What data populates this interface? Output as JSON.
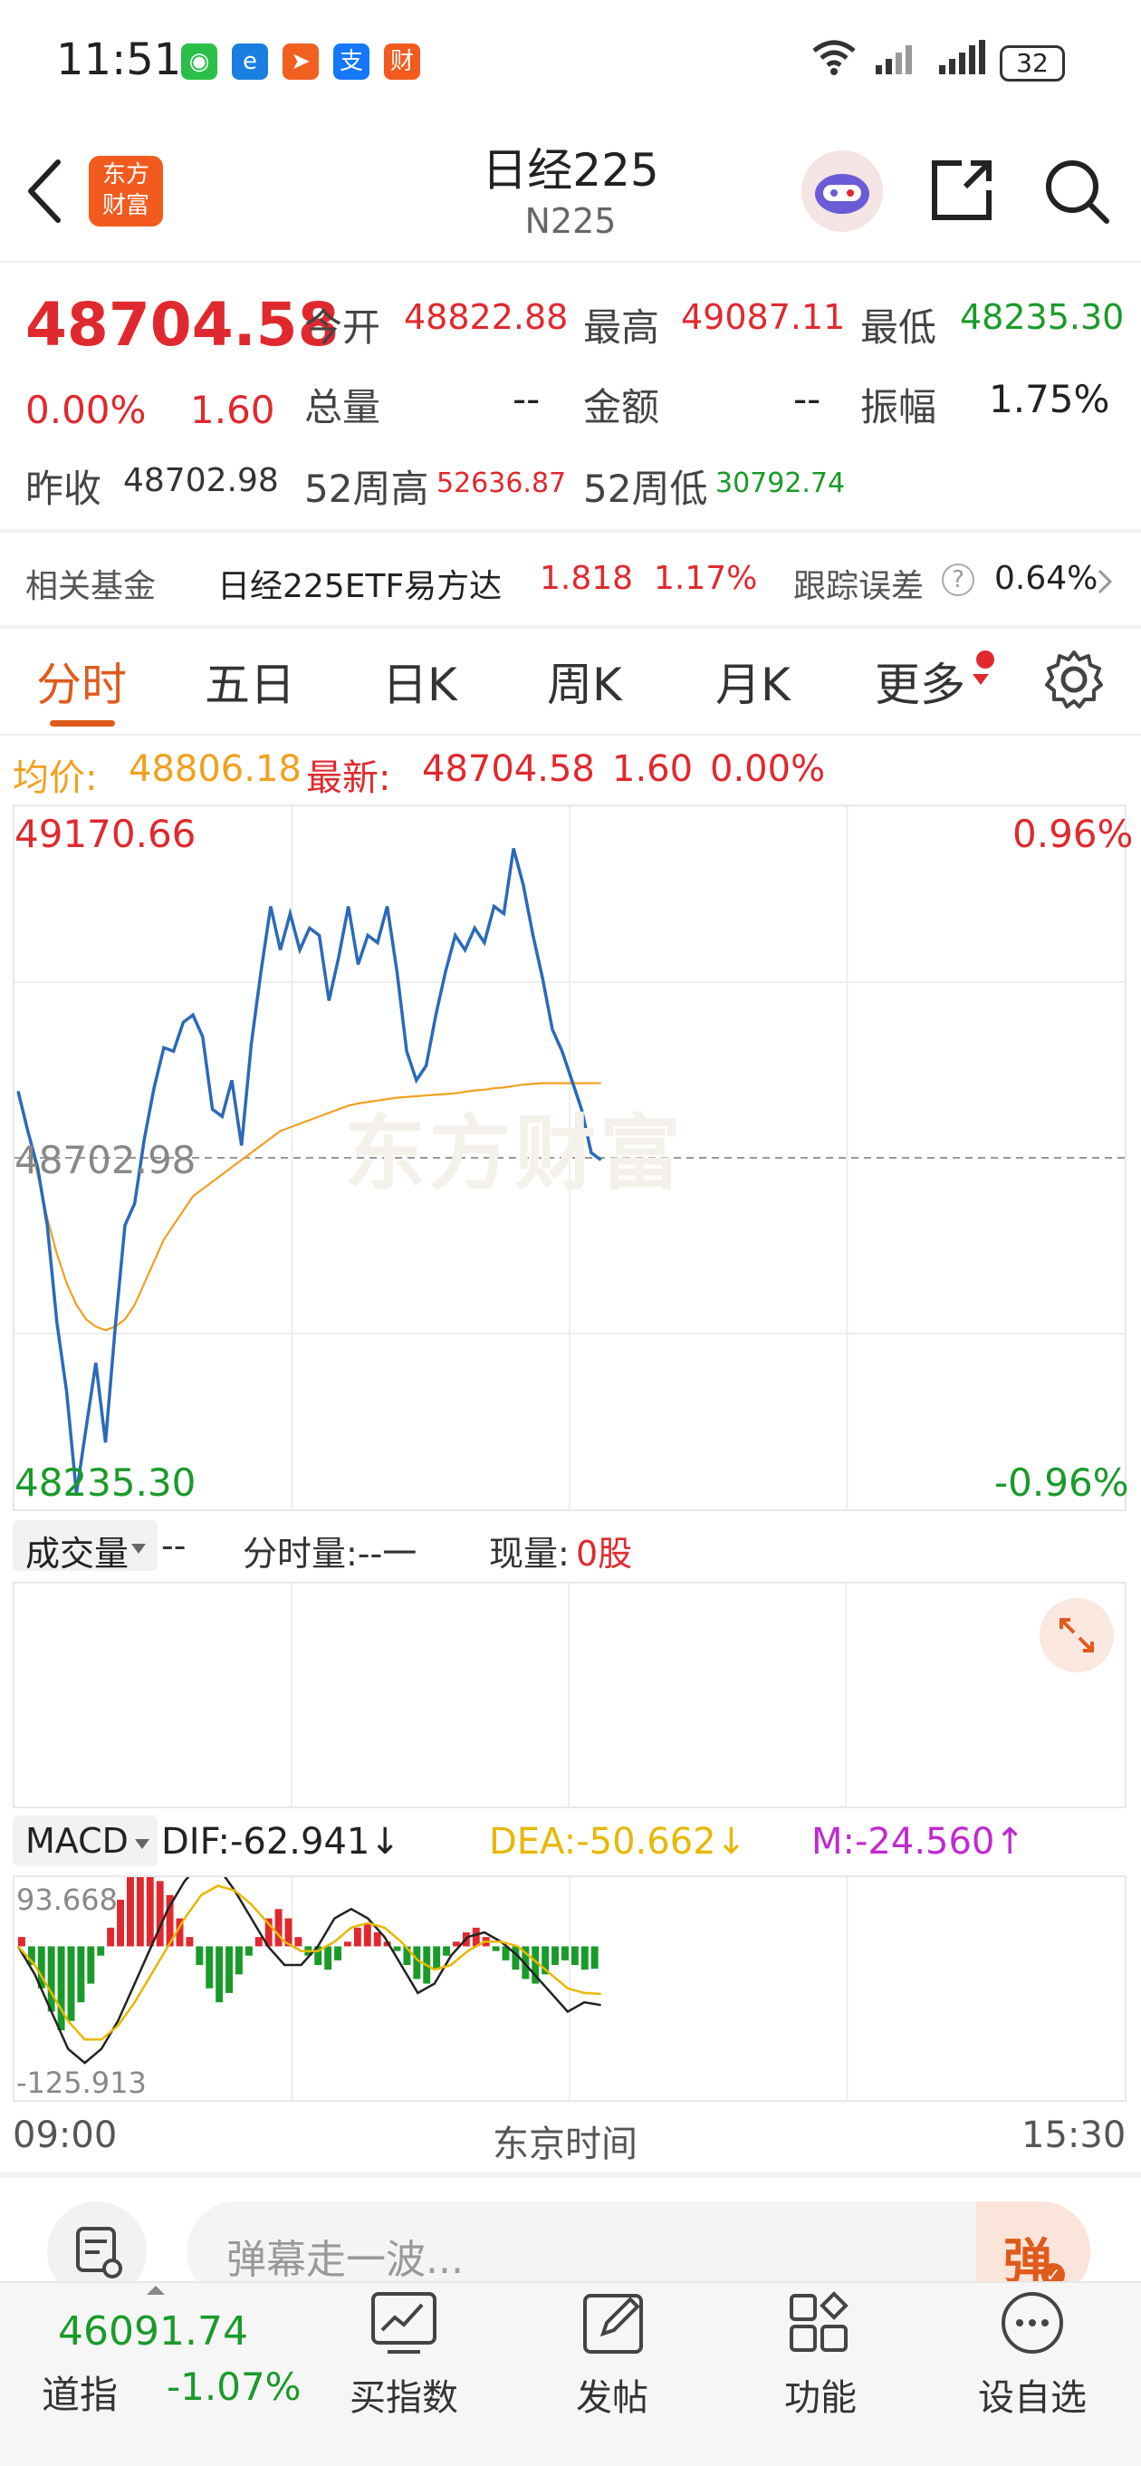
{
  "status_bar": {
    "time": "11:51",
    "battery": "32",
    "app_icons": [
      {
        "name": "wechat-icon",
        "color": "#2bbf4a",
        "glyph": "◉"
      },
      {
        "name": "browser-icon",
        "color": "#1a7ee0",
        "glyph": "e"
      },
      {
        "name": "send-app-icon",
        "color": "#f06020",
        "glyph": "➤"
      },
      {
        "name": "alipay-icon",
        "color": "#1677ff",
        "glyph": "支"
      },
      {
        "name": "eastmoney-app-icon",
        "color": "#f25a1e",
        "glyph": "财"
      }
    ]
  },
  "header": {
    "title": "日经225",
    "subtitle": "N225",
    "logo_text": "东方财富"
  },
  "quote": {
    "price": "48704.58",
    "change_pct": "0.00%",
    "change": "1.60",
    "open_label": "今开",
    "open": "48822.88",
    "high_label": "最高",
    "high": "49087.11",
    "low_label": "最低",
    "low": "48235.30",
    "volume_label": "总量",
    "volume": "--",
    "amount_label": "金额",
    "amount": "--",
    "amplitude_label": "振幅",
    "amplitude": "1.75%",
    "prev_close_label": "昨收",
    "prev_close": "48702.98",
    "wk52_high_label": "52周高",
    "wk52_high": "52636.87",
    "wk52_low_label": "52周低",
    "wk52_low": "30792.74"
  },
  "fund": {
    "label": "相关基金",
    "name": "日经225ETF易方达",
    "price": "1.818",
    "pct": "1.17%",
    "tracking_label": "跟踪误差",
    "tracking_value": "0.64%"
  },
  "tabs": [
    "分时",
    "五日",
    "日K",
    "周K",
    "月K",
    "更多"
  ],
  "info_row": {
    "avg_label": "均价:",
    "avg": "48806.18",
    "latest_label": "最新:",
    "latest": "48704.58",
    "change": "1.60",
    "pct": "0.00%"
  },
  "chart_labels": {
    "top_price": "49170.66",
    "mid_price": "48702.98",
    "bottom_price": "48235.30",
    "top_pct": "0.96%",
    "bottom_pct": "-0.96%",
    "watermark": "东方财富"
  },
  "volume_header": {
    "select": "成交量",
    "dash": "--",
    "minute_vol": "分时量:--一",
    "current_label": "现量:",
    "current_value": "0股"
  },
  "macd_header": {
    "select": "MACD",
    "dif": "DIF:-62.941↓",
    "dea": "DEA:-50.662↓",
    "m": "M:-24.560↑",
    "top": "93.668",
    "bottom": "-125.913"
  },
  "time_axis": {
    "start": "09:00",
    "middle": "东京时间",
    "end": "15:30"
  },
  "danmu": {
    "placeholder": "弹幕走一波...",
    "button": "弹"
  },
  "bottom_nav": {
    "dow_price": "46091.74",
    "dow_label": "道指",
    "dow_pct": "-1.07%",
    "items": [
      {
        "label": "买指数",
        "icon": "chart-trend-icon"
      },
      {
        "label": "发帖",
        "icon": "edit-icon"
      },
      {
        "label": "功能",
        "icon": "grid-icon"
      },
      {
        "label": "设自选",
        "icon": "more-icon"
      }
    ]
  },
  "chart_data": [
    {
      "type": "line",
      "title": "",
      "xlabel": "东京时间",
      "ylabel": "",
      "x_range": [
        "09:00",
        "15:30"
      ],
      "ylim": [
        48235.3,
        49170.66
      ],
      "reference_line": 48702.98,
      "series": [
        {
          "name": "最新",
          "color": "#2a6ab8",
          "values": [
            48795,
            48740,
            48690,
            48610,
            48475,
            48380,
            48240,
            48330,
            48420,
            48310,
            48470,
            48610,
            48640,
            48730,
            48800,
            48855,
            48850,
            48890,
            48900,
            48870,
            48770,
            48760,
            48810,
            48720,
            48860,
            48960,
            49050,
            48990,
            49040,
            48990,
            49020,
            49010,
            48920,
            48980,
            49050,
            48970,
            49010,
            49000,
            49050,
            48960,
            48850,
            48810,
            48830,
            48900,
            48960,
            49010,
            48990,
            49020,
            49000,
            49050,
            49040,
            49130,
            49080,
            49010,
            48950,
            48880,
            48850,
            48810,
            48770,
            48710,
            48700
          ]
        },
        {
          "name": "均价",
          "color": "#f0a020",
          "values": [
            48790,
            48740,
            48680,
            48620,
            48570,
            48530,
            48500,
            48480,
            48470,
            48465,
            48470,
            48480,
            48500,
            48530,
            48560,
            48590,
            48610,
            48630,
            48650,
            48660,
            48670,
            48680,
            48690,
            48700,
            48710,
            48720,
            48730,
            48740,
            48745,
            48750,
            48755,
            48760,
            48765,
            48770,
            48775,
            48778,
            48780,
            48782,
            48784,
            48786,
            48787,
            48788,
            48789,
            48790,
            48791,
            48792,
            48794,
            48796,
            48797,
            48799,
            48800,
            48802,
            48804,
            48805,
            48806,
            48806,
            48806,
            48806,
            48806,
            48806,
            48806
          ]
        }
      ]
    },
    {
      "type": "bar",
      "title": "",
      "xlabel": "",
      "ylabel": "",
      "ylim": [
        -125.913,
        93.668
      ],
      "series": [
        {
          "name": "MACD",
          "values": [
            10,
            -20,
            -45,
            -70,
            -90,
            -80,
            -60,
            -40,
            -10,
            20,
            50,
            80,
            93,
            85,
            70,
            55,
            30,
            10,
            -20,
            -45,
            -60,
            -50,
            -30,
            -10,
            10,
            30,
            40,
            30,
            10,
            -10,
            -20,
            -25,
            -15,
            5,
            20,
            25,
            15,
            5,
            -5,
            -20,
            -35,
            -40,
            -25,
            -10,
            5,
            15,
            20,
            10,
            -5,
            -15,
            -25,
            -35,
            -40,
            -30,
            -20,
            -15,
            -20,
            -25,
            -24
          ]
        },
        {
          "name": "DIF",
          "values": [
            0,
            -30,
            -70,
            -110,
            -125,
            -110,
            -80,
            -40,
            0,
            40,
            70,
            90,
            85,
            60,
            30,
            0,
            -20,
            -20,
            0,
            30,
            40,
            30,
            10,
            -20,
            -50,
            -40,
            -10,
            10,
            15,
            5,
            -10,
            -30,
            -50,
            -70,
            -60,
            -63
          ]
        },
        {
          "name": "DEA",
          "values": [
            0,
            -20,
            -50,
            -80,
            -100,
            -100,
            -85,
            -60,
            -30,
            0,
            30,
            55,
            65,
            60,
            45,
            25,
            5,
            -5,
            -5,
            5,
            20,
            25,
            20,
            5,
            -15,
            -25,
            -20,
            -5,
            5,
            5,
            0,
            -15,
            -30,
            -45,
            -50,
            -51
          ]
        }
      ]
    }
  ]
}
